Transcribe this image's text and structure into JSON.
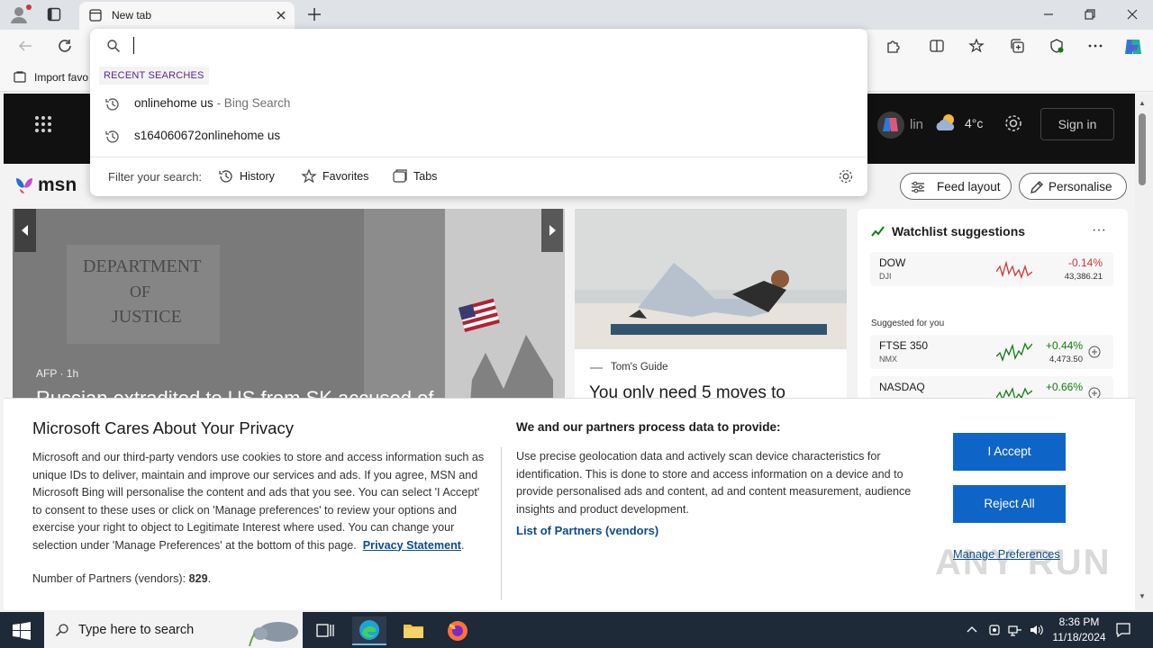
{
  "browser": {
    "tab_title": "New tab",
    "favbar_label": "Import favo"
  },
  "omnibox": {
    "input_value": "",
    "recent_header": "RECENT SEARCHES",
    "recent": [
      {
        "text": "onlinehome us",
        "suffix": " - Bing Search"
      },
      {
        "text": "s164060672onlinehome us",
        "suffix": ""
      }
    ],
    "filter_label": "Filter your search:",
    "filters": [
      "History",
      "Favorites",
      "Tabs"
    ]
  },
  "msn": {
    "logo": "msn",
    "bing_label": "lin",
    "temperature": "4°c",
    "signin": "Sign in",
    "feed_layout": "Feed layout",
    "personalise": "Personalise",
    "hero_source": "AFP · 1h",
    "hero_headline": "Russian extradited to US from SK accused of",
    "story_source": "Tom's Guide",
    "story_headline": "You only need 5 moves to",
    "watchlist_title": "Watchlist suggestions",
    "watchlist_more": "···",
    "suggested_label": "Suggested for you",
    "stocks": [
      {
        "name": "DOW",
        "sub": "DJI",
        "change": "-0.14%",
        "price": "43,386.21",
        "color": "#d13438"
      },
      {
        "name": "FTSE 350",
        "sub": "NMX",
        "change": "+0.44%",
        "price": "4,473.50",
        "color": "#107c10"
      },
      {
        "name": "NASDAQ",
        "sub": "",
        "change": "+0.66%",
        "price": "",
        "color": "#107c10"
      }
    ]
  },
  "privacy": {
    "title": "Microsoft Cares About Your Privacy",
    "body": "Microsoft and our third-party vendors use cookies to store and access information such as unique IDs to deliver, maintain and improve our services and ads. If you agree, MSN and Microsoft Bing will personalise the content and ads that you see. You can select 'I Accept' to consent to these uses or click on 'Manage preferences' to review your options and exercise your right to object to Legitimate Interest where used.  You can change your selection under 'Manage Preferences' at the bottom of this page.",
    "privacy_link": "Privacy Statement",
    "count_label": "Number of Partners (vendors):",
    "count_value": "829",
    "subtitle": "We and our partners process data to provide:",
    "description": "Use precise geolocation data and actively scan device characteristics for identification. This is done to store and access information on a device and to provide personalised ads and content, ad and content measurement, audience insights and product development.",
    "partners_link": "List of Partners (vendors)",
    "accept": "I Accept",
    "reject": "Reject All",
    "manage": "Manage Preferences",
    "watermark": "ANY RUN"
  },
  "taskbar": {
    "search_placeholder": "Type here to search",
    "time": "8:36 PM",
    "date": "11/18/2024"
  },
  "colors": {
    "accent": "#0f65c7",
    "link": "#0a4b8c",
    "negative": "#d13438",
    "positive": "#107c10"
  }
}
